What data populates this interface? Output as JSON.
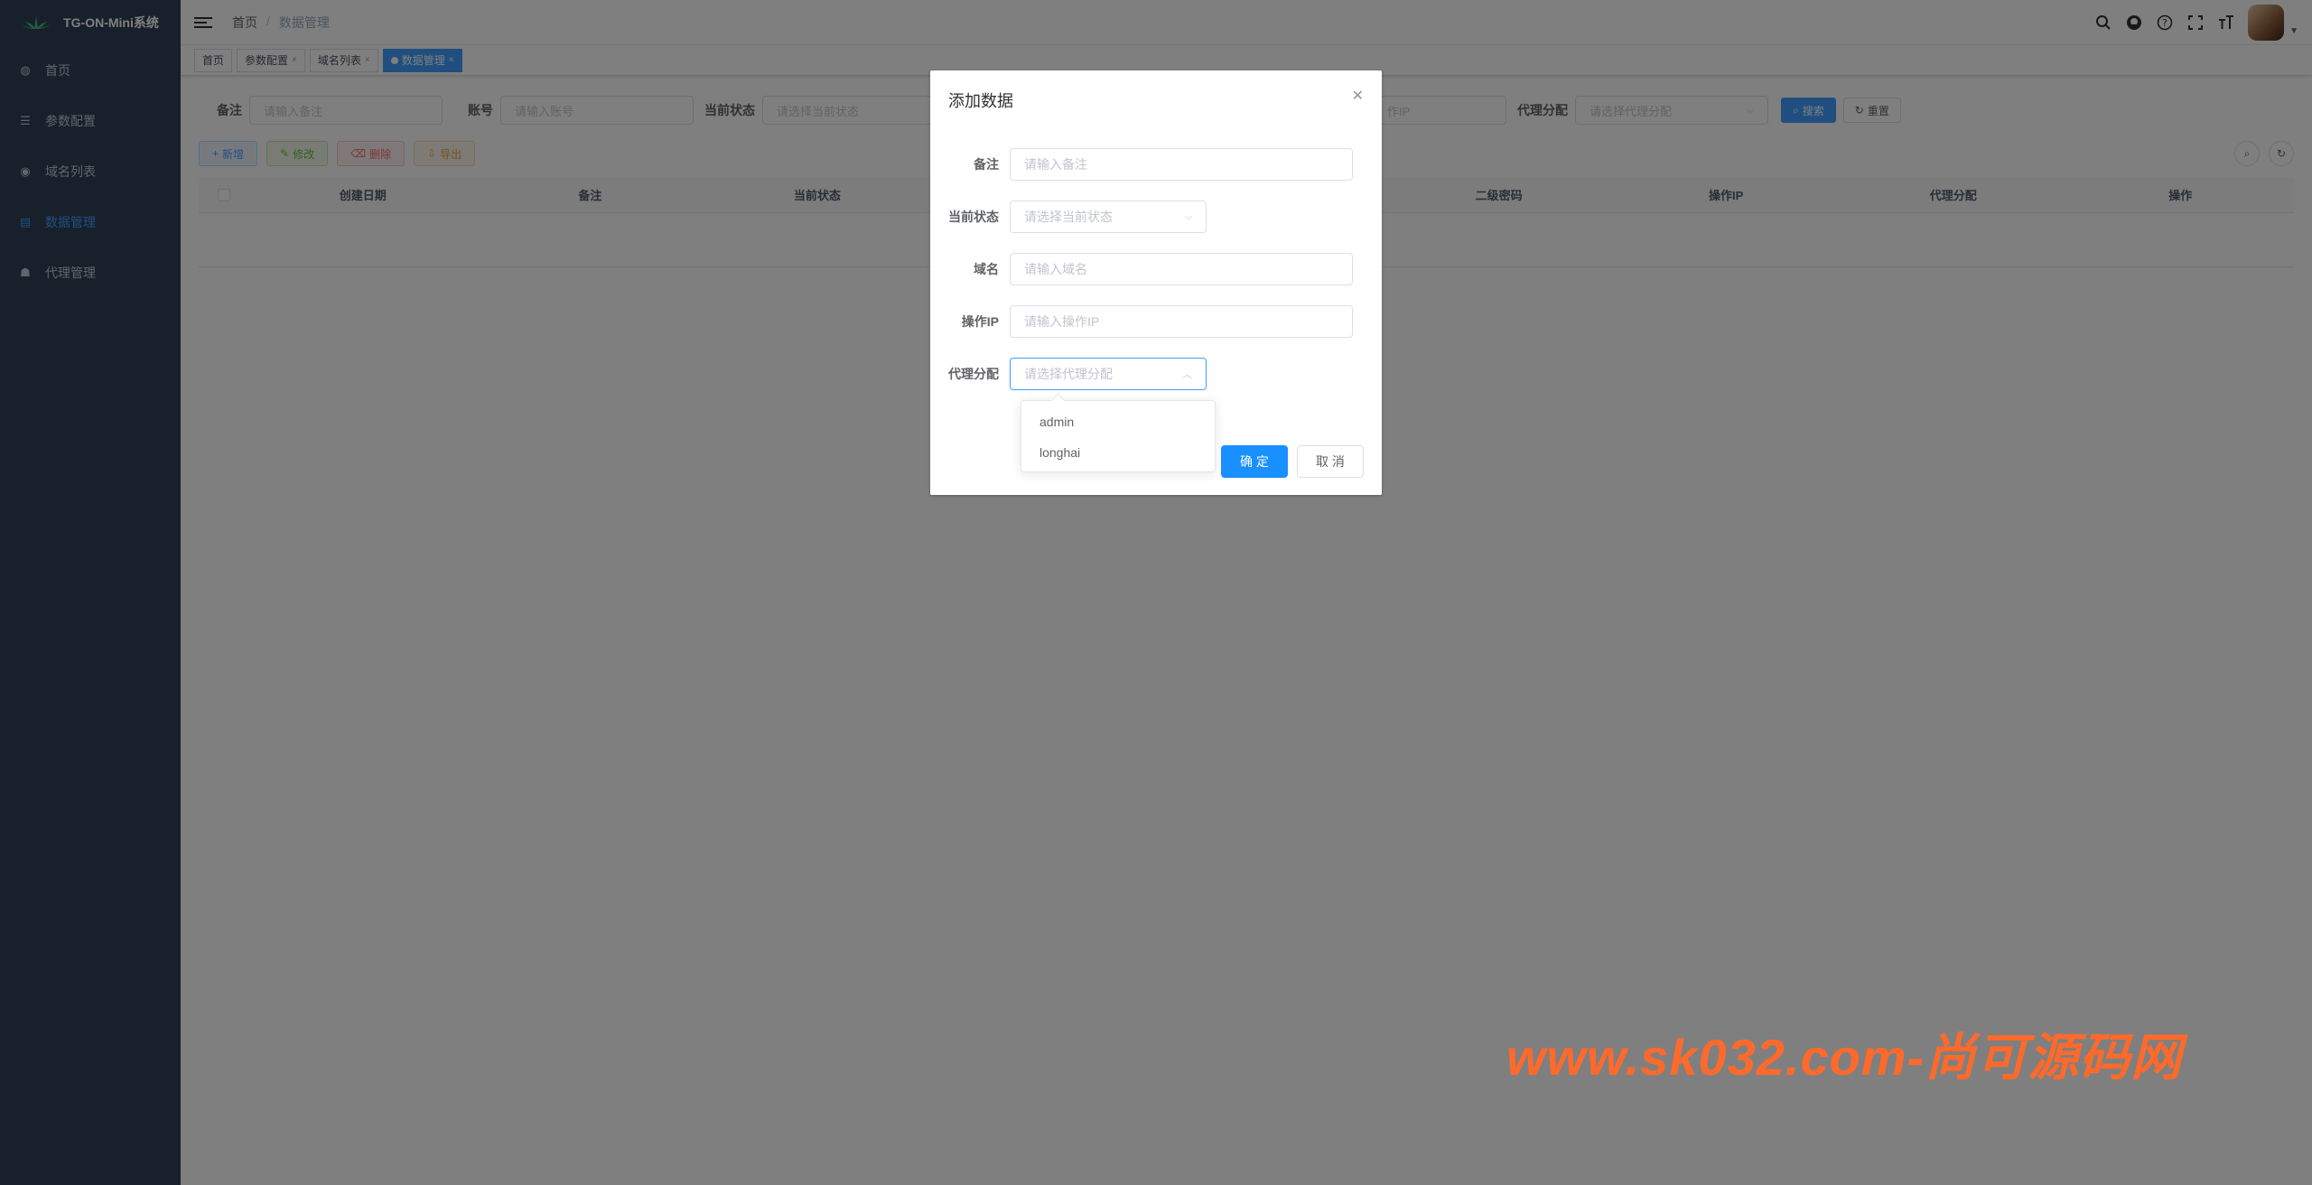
{
  "app": {
    "title": "TG-ON-Mini系统"
  },
  "sidebar": {
    "items": [
      {
        "label": "首页",
        "icon": "dashboard-icon",
        "glyph": "◍"
      },
      {
        "label": "参数配置",
        "icon": "sliders-icon",
        "glyph": "☰"
      },
      {
        "label": "域名列表",
        "icon": "globe-icon",
        "glyph": "◉"
      },
      {
        "label": "数据管理",
        "icon": "database-icon",
        "glyph": "▤"
      },
      {
        "label": "代理管理",
        "icon": "users-icon",
        "glyph": "☗"
      }
    ],
    "active_index": 3
  },
  "navbar": {
    "breadcrumb": [
      "首页",
      "数据管理"
    ],
    "separator": "/"
  },
  "tags": [
    {
      "label": "首页",
      "closable": false
    },
    {
      "label": "参数配置",
      "closable": true
    },
    {
      "label": "域名列表",
      "closable": true
    },
    {
      "label": "数据管理",
      "closable": true,
      "active": true
    }
  ],
  "search": {
    "fields": [
      {
        "label": "备注",
        "placeholder": "请输入备注"
      },
      {
        "label": "账号",
        "placeholder": "请输入账号"
      },
      {
        "label": "当前状态",
        "placeholder": "请选择当前状态"
      },
      {
        "label": "代理分配",
        "placeholder": "请选择代理分配"
      }
    ],
    "hidden_ip_placeholder": "作IP",
    "search_label": "搜索",
    "reset_label": "重置"
  },
  "toolbar": {
    "add_label": "新增",
    "edit_label": "修改",
    "delete_label": "删除",
    "export_label": "导出"
  },
  "table": {
    "columns": [
      "创建日期",
      "备注",
      "当前状态",
      "",
      "",
      "二级密码",
      "操作IP",
      "代理分配",
      "操作"
    ]
  },
  "dialog": {
    "title": "添加数据",
    "fields": {
      "remark": {
        "label": "备注",
        "placeholder": "请输入备注"
      },
      "status": {
        "label": "当前状态",
        "placeholder": "请选择当前状态"
      },
      "domain": {
        "label": "域名",
        "placeholder": "请输入域名"
      },
      "ip": {
        "label": "操作IP",
        "placeholder": "请输入操作IP"
      },
      "agent": {
        "label": "代理分配",
        "placeholder": "请选择代理分配"
      }
    },
    "agent_options": [
      "admin",
      "longhai"
    ],
    "ok_label": "确 定",
    "cancel_label": "取 消"
  },
  "watermark": "www.sk032.com-尚可源码网",
  "colors": {
    "sidebar_bg": "#304156",
    "primary": "#409eff",
    "watermark": "#ff6a2b"
  }
}
